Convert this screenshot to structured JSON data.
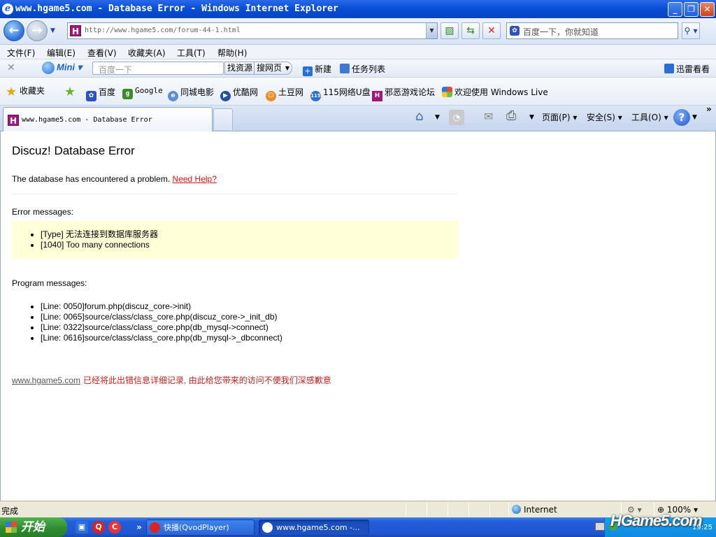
{
  "window": {
    "title": "www.hgame5.com - Database Error - Windows Internet Explorer"
  },
  "address": {
    "url": "http://www.hgame5.com/forum-44-1.html"
  },
  "search": {
    "placeholder": "百度一下，你就知道"
  },
  "menu": [
    "文件(F)",
    "编辑(E)",
    "查看(V)",
    "收藏夹(A)",
    "工具(T)",
    "帮助(H)"
  ],
  "baidu_bar": {
    "mini_label": "Mini",
    "input_placeholder": "百度一下",
    "btn_find": "找资源",
    "btn_search": "搜网页",
    "new_label": "新建",
    "tasks_label": "任务列表",
    "xunlei_label": "迅雷看看"
  },
  "favorites": {
    "favorites_label": "收藏夹",
    "items": [
      "百度",
      "Google",
      "同城电影",
      "优酷网",
      "土豆网",
      "115网络U盘",
      "邪恶游戏论坛",
      "欢迎使用 Windows Live"
    ]
  },
  "tabs": [
    {
      "label": "www.hgame5.com - Database Error"
    }
  ],
  "commands": {
    "page": "页面(P)",
    "safety": "安全(S)",
    "tools": "工具(O)"
  },
  "page": {
    "heading": "Discuz! Database Error",
    "intro": "The database has encountered a problem.",
    "help_link": "Need Help?",
    "error_title": "Error messages:",
    "errors": [
      "[Type] 无法连接到数据库服务器",
      "[1040] Too many connections"
    ],
    "program_title": "Program messages:",
    "program": [
      "[Line: 0050]forum.php(discuz_core->init)",
      "[Line: 0065]source/class/class_core.php(discuz_core->_init_db)",
      "[Line: 0322]source/class/class_core.php(db_mysql->connect)",
      "[Line: 0616]source/class/class_core.php(db_mysql->_dbconnect)"
    ],
    "footer_site": "www.hgame5.com",
    "footer_text": "已经将此出错信息详细记录, 由此给您带来的访问不便我们深感歉意"
  },
  "status": {
    "left": "完成",
    "zone": "Internet",
    "zoom": "100%"
  },
  "taskbar": {
    "start": "开始",
    "tasks": [
      "快播(QvodPlayer)",
      "www.hgame5.com -..."
    ],
    "watermark": "HGame5.com",
    "clock": "19:25"
  }
}
